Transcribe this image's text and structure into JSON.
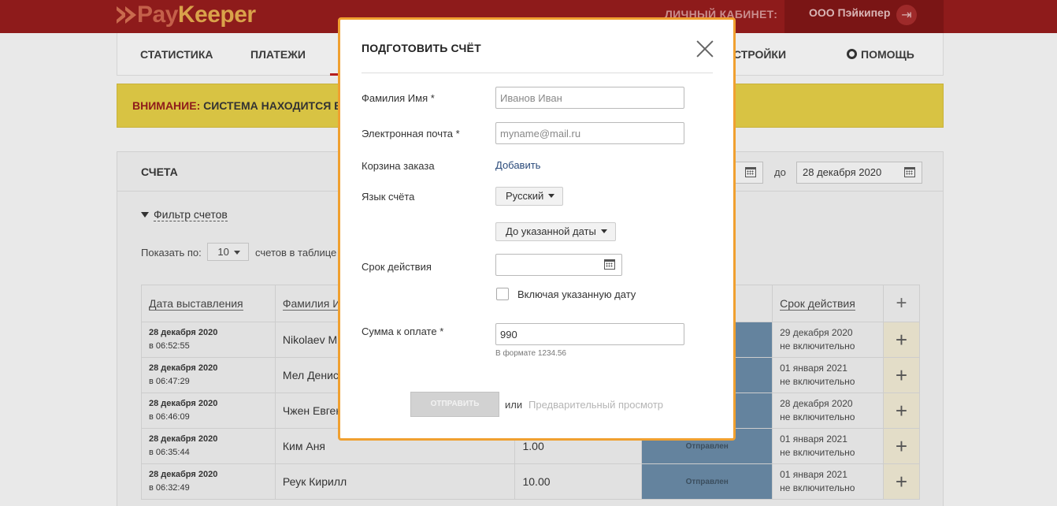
{
  "header": {
    "logo_pay": "Pay",
    "logo_keeper": "Keeper",
    "cabinet_label": "ЛИЧНЫЙ КАБИНЕТ:",
    "account_name": "ООО Пэйкипер",
    "account_icon": "logout-icon",
    "brand_color": "#8e1b1b"
  },
  "nav": {
    "items": [
      "СТАТИСТИКА",
      "ПЛАТЕЖИ",
      "СТРОЙКИ",
      "ПОМОЩЬ"
    ],
    "help_icon": "lifebuoy-icon"
  },
  "warning": {
    "label": "ВНИМАНИЕ:",
    "text": "СИСТЕМА НАХОДИТСЯ В"
  },
  "panel": {
    "title": "СЧЕТА",
    "date_to_label": "до",
    "date_to": "28 декабря 2020",
    "filter_label": "Фильтр счетов",
    "show_prefix": "Показать по:",
    "per_page": "10",
    "show_suffix": "счетов в таблице"
  },
  "table": {
    "headers": [
      "Дата выставления",
      "Фамилия И",
      "",
      "",
      "Срок действия",
      "+"
    ],
    "rows": [
      {
        "date": "28 декабря 2020",
        "time": "в 06:52:55",
        "name": "Nikolaev Mi",
        "amount": "",
        "status": "",
        "term1": "29 декабря 2020",
        "term2": "не включительно"
      },
      {
        "date": "28 декабря 2020",
        "time": "в 06:47:29",
        "name": "Мел Денис",
        "amount": "",
        "status": "",
        "term1": "01 января 2021",
        "term2": "не включительно"
      },
      {
        "date": "28 декабря 2020",
        "time": "в 06:46:09",
        "name": "Чжен Евген",
        "amount": "",
        "status": "",
        "term1": "28 декабря 2020",
        "term2": "не включительно"
      },
      {
        "date": "28 декабря 2020",
        "time": "в 06:35:44",
        "name": "Ким Аня",
        "amount": "1.00",
        "status": "Отправлен",
        "term1": "01 января 2021",
        "term2": "не включительно"
      },
      {
        "date": "28 декабря 2020",
        "time": "в 06:32:49",
        "name": "Реук Кирилл",
        "amount": "10.00",
        "status": "Отправлен",
        "term1": "01 января 2021",
        "term2": "не включительно"
      }
    ]
  },
  "modal": {
    "title": "ПОДГОТОВИТЬ СЧЁТ",
    "name_label": "Фамилия Имя *",
    "name_placeholder": "Иванов Иван",
    "email_label": "Электронная почта *",
    "email_placeholder": "myname@mail.ru",
    "cart_label": "Корзина заказа",
    "cart_add": "Добавить",
    "lang_label": "Язык счёта",
    "lang_value": "Русский",
    "expiry_mode": "До указанной даты",
    "expiry_label": "Срок действия",
    "include_date_label": "Включая указанную дату",
    "amount_label": "Сумма к оплате *",
    "amount_value": "990",
    "amount_hint": "В формате 1234.56",
    "send_label": "ОТПРАВИТЬ",
    "or_text": "или",
    "preview_label": "Предварительный просмотр",
    "accent_color": "#f0a030"
  }
}
